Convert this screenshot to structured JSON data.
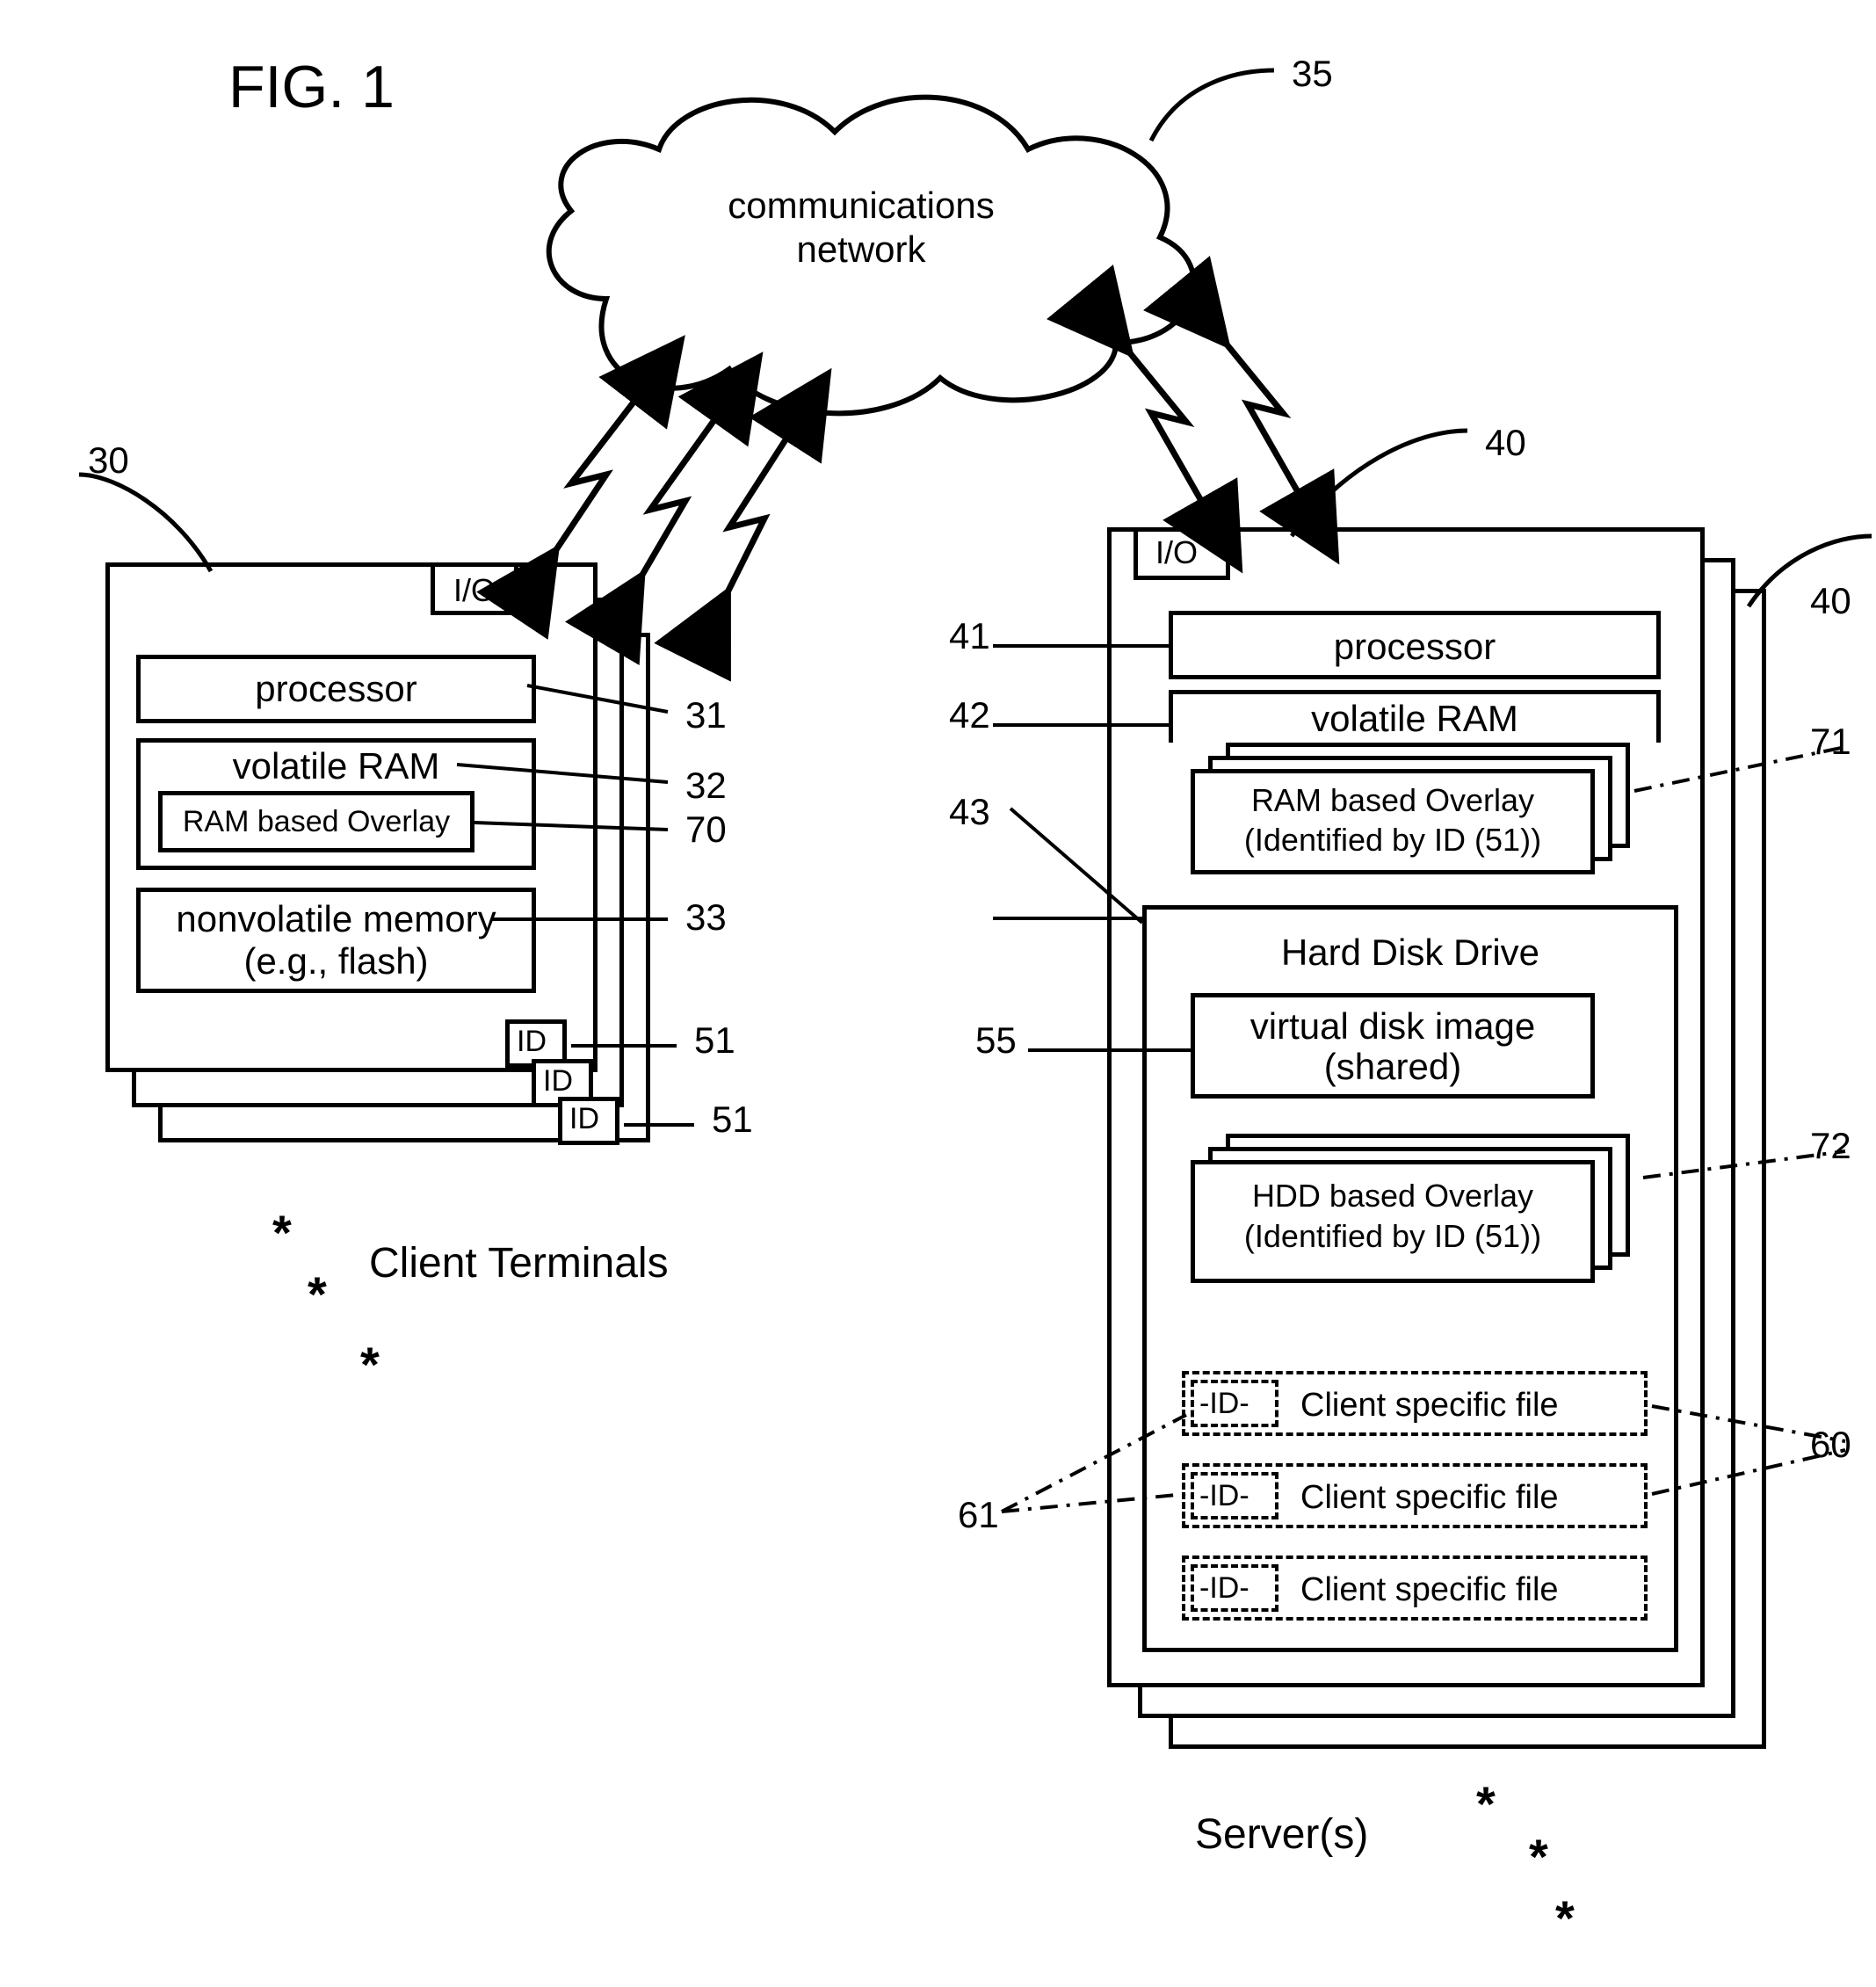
{
  "title": "FIG. 1",
  "cloud": {
    "label_l1": "communications",
    "label_l2": "network",
    "ref": "35"
  },
  "client": {
    "ref": "30",
    "io": "I/O",
    "processor": "processor",
    "ram": "volatile RAM",
    "ram_overlay": "RAM based Overlay",
    "nvm_l1": "nonvolatile memory",
    "nvm_l2": "(e.g., flash)",
    "id": "ID",
    "caption": "Client Terminals",
    "refs": {
      "proc": "31",
      "ram": "32",
      "overlay": "70",
      "nvm": "33",
      "id1": "51",
      "id2": "51"
    }
  },
  "server": {
    "ref_a": "40",
    "ref_b": "40",
    "io": "I/O",
    "processor": "processor",
    "ram": "volatile RAM",
    "ram_overlay_l1": "RAM based Overlay",
    "ram_overlay_l2": "(Identified by ID (51))",
    "hdd": "Hard Disk Drive",
    "vdi_l1": "virtual disk image",
    "vdi_l2": "(shared)",
    "hdd_overlay_l1": "HDD based Overlay",
    "hdd_overlay_l2": "(Identified by ID (51))",
    "file_id": "-ID-",
    "file_label": "Client specific file",
    "caption": "Server(s)",
    "refs": {
      "proc": "41",
      "ram": "42",
      "hdd": "43",
      "vdi": "55",
      "ram_overlay": "71",
      "hdd_overlay": "72",
      "files": "60",
      "file_id": "61"
    }
  }
}
